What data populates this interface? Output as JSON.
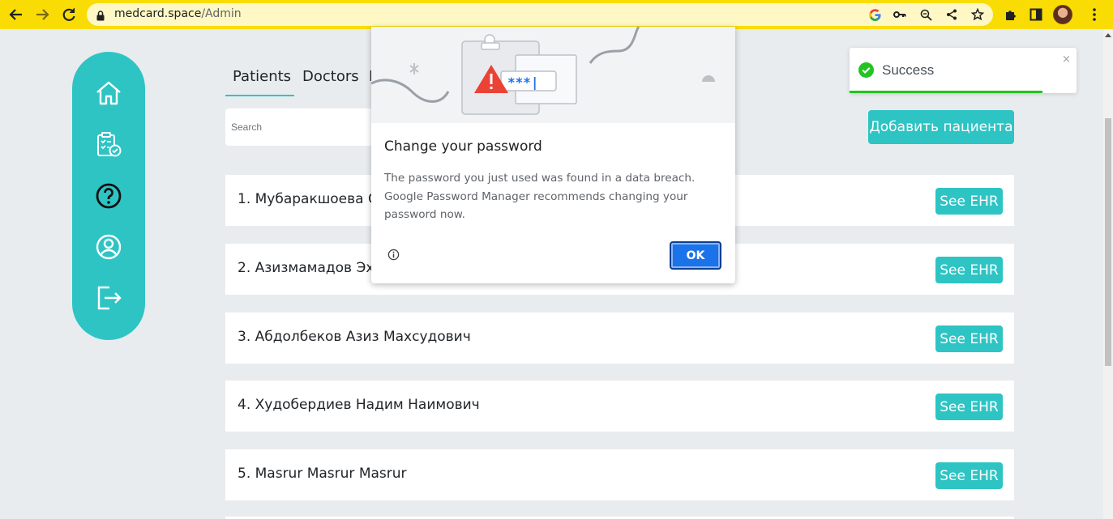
{
  "browser": {
    "url_host": "medcard.space",
    "url_path": "/Admin"
  },
  "colors": {
    "chrome_bar": "#f9dc04",
    "accent": "#2ec4c4",
    "toast_success": "#22c422",
    "dialog_ok": "#1a73e8"
  },
  "sidebar": {
    "items": [
      {
        "icon": "home-icon"
      },
      {
        "icon": "clipboard-check-icon"
      },
      {
        "icon": "help-icon"
      },
      {
        "icon": "user-icon"
      },
      {
        "icon": "logout-icon"
      }
    ]
  },
  "tabs": [
    {
      "label": "Patients",
      "active": true
    },
    {
      "label": "Doctors",
      "active": false
    },
    {
      "label": "I",
      "active": false
    }
  ],
  "search": {
    "placeholder": "Search",
    "value": ""
  },
  "add_button": "Добавить пациента",
  "patients": [
    {
      "name": "1. Мубаракшоева С",
      "button": "See EHR"
    },
    {
      "name": "2. Азизмамадов Эхс",
      "button": "See EHR"
    },
    {
      "name": "3. Абдолбеков Азиз Махсудович",
      "button": "See EHR"
    },
    {
      "name": "4. Худобердиев Надим Наимович",
      "button": "See EHR"
    },
    {
      "name": "5. Masrur Masrur Masrur",
      "button": "See EHR"
    }
  ],
  "toast": {
    "message": "Success",
    "close": "×",
    "progress_fraction": 0.85
  },
  "dialog": {
    "title": "Change your password",
    "body": "The password you just used was found in a data breach. Google Password Manager recommends changing your password now.",
    "ok": "OK",
    "password_mask": "***|"
  }
}
